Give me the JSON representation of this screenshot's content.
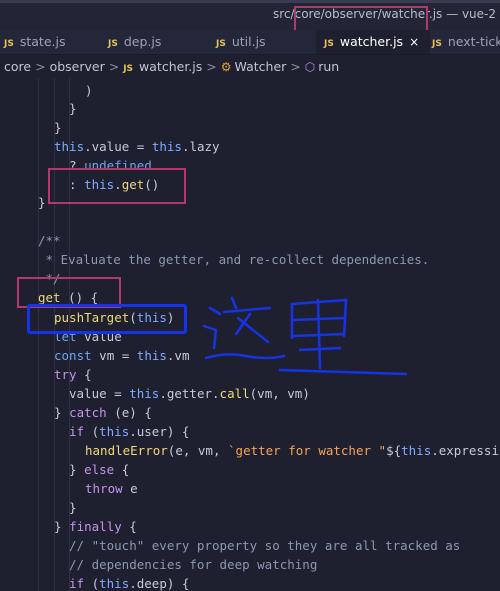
{
  "window": {
    "title": "src/core/observer/watcher.js — vue-2"
  },
  "tabs": [
    {
      "badge": "JS",
      "label": "state.js"
    },
    {
      "badge": "JS",
      "label": "dep.js"
    },
    {
      "badge": "JS",
      "label": "util.js"
    },
    {
      "badge": "JS",
      "label": "watcher.js",
      "close": "×"
    },
    {
      "badge": "JS",
      "label": "next-tick.js"
    }
  ],
  "breadcrumb": {
    "items": [
      "core",
      "observer",
      "watcher.js",
      "Watcher",
      "run"
    ],
    "separator": ">",
    "file_badge": "JS",
    "class_icon": "class-icon",
    "method_icon": "method-icon"
  },
  "code": {
    "lines": [
      ")",
      "}",
      "}",
      "this.value = this.lazy",
      "? undefined",
      ": this.get()",
      "}",
      "",
      "/**",
      " * Evaluate the getter, and re-collect dependencies.",
      " */",
      "get () {",
      "pushTarget(this)",
      "let value",
      "const vm = this.vm",
      "try {",
      "value = this.getter.call(vm, vm)",
      "} catch (e) {",
      "if (this.user) {",
      "handleError(e, vm, `getter for watcher \"${this.expression}\"`)",
      "} else {",
      "throw e",
      "}",
      "} finally {",
      "// \"touch\" every property so they are all tracked as",
      "// dependencies for deep watching",
      "if (this.deep) {"
    ]
  },
  "annotations": {
    "handwritten_note": "这里",
    "colors": {
      "red_box": "#b23a6a",
      "blue_box": "#1633e6",
      "ink": "#1633e6"
    }
  },
  "theme": {
    "background": "#1e2030",
    "keyword": "#6fa3f2",
    "function": "#f0d77a",
    "string": "#f5a35a",
    "comment": "#8e97b3"
  }
}
